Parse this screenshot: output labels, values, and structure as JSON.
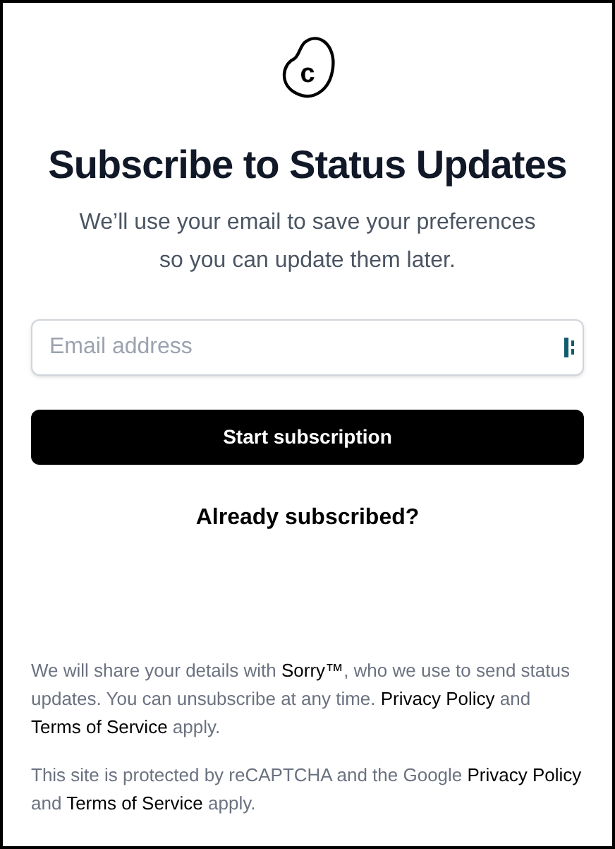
{
  "logo": {
    "letter": "c"
  },
  "title": "Subscribe to Status Updates",
  "subtitle": "We’ll use your email to save your preferences so you can update them later.",
  "email_field": {
    "placeholder": "Email address"
  },
  "submit_button": "Start subscription",
  "already_subscribed_link": "Already subscribed?",
  "footer_paragraphs": [
    [
      {
        "text": "We will share your details with ",
        "link": false
      },
      {
        "text": "Sorry™",
        "link": true
      },
      {
        "text": ", who we use to send status updates. You can unsubscribe at any time. ",
        "link": false
      },
      {
        "text": "Privacy Policy",
        "link": true
      },
      {
        "text": " and ",
        "link": false
      },
      {
        "text": "Terms of Service",
        "link": true
      },
      {
        "text": " apply.",
        "link": false
      }
    ],
    [
      {
        "text": "This site is protected by reCAPTCHA and the Google ",
        "link": false
      },
      {
        "text": "Privacy Policy",
        "link": true
      },
      {
        "text": " and ",
        "link": false
      },
      {
        "text": "Terms of Service",
        "link": true
      },
      {
        "text": " apply.",
        "link": false
      }
    ]
  ]
}
